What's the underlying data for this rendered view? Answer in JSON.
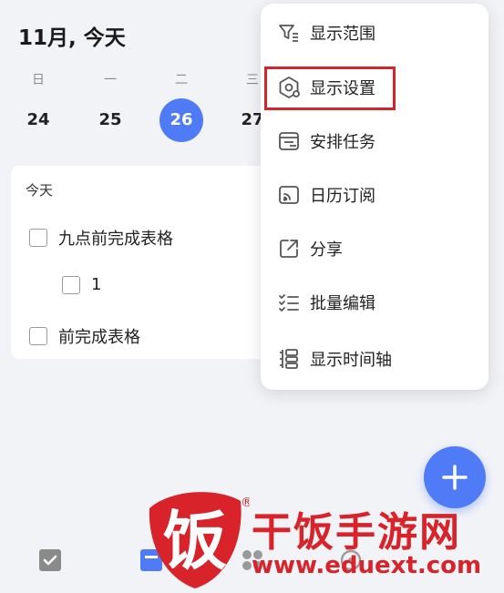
{
  "header": {
    "title": "11月, 今天"
  },
  "week": [
    {
      "weekday": "日",
      "day": "24",
      "active": false
    },
    {
      "weekday": "一",
      "day": "25",
      "active": false
    },
    {
      "weekday": "二",
      "day": "26",
      "active": true
    },
    {
      "weekday": "三",
      "day": "27",
      "active": false
    }
  ],
  "card": {
    "section": "今天",
    "tasks": [
      {
        "label": "九点前完成表格"
      },
      {
        "label": "1"
      },
      {
        "label": "前完成表格"
      }
    ]
  },
  "menu": {
    "items": [
      {
        "label": "显示范围",
        "icon": "filter-icon"
      },
      {
        "label": "显示设置",
        "icon": "settings-hexagon-icon"
      },
      {
        "label": "安排任务",
        "icon": "schedule-task-icon"
      },
      {
        "label": "日历订阅",
        "icon": "calendar-subscribe-icon"
      },
      {
        "label": "分享",
        "icon": "share-icon"
      },
      {
        "label": "批量编辑",
        "icon": "batch-edit-icon"
      },
      {
        "label": "显示时间轴",
        "icon": "timeline-icon"
      }
    ]
  },
  "fab": {
    "icon": "plus-icon"
  },
  "watermark": {
    "title": "干饭手游网",
    "url": "www.eduext.com",
    "mark": "饭",
    "registered": "®"
  },
  "colors": {
    "accent": "#4f7cf6",
    "highlight_border": "#d2262b",
    "watermark": "#d8232a"
  }
}
